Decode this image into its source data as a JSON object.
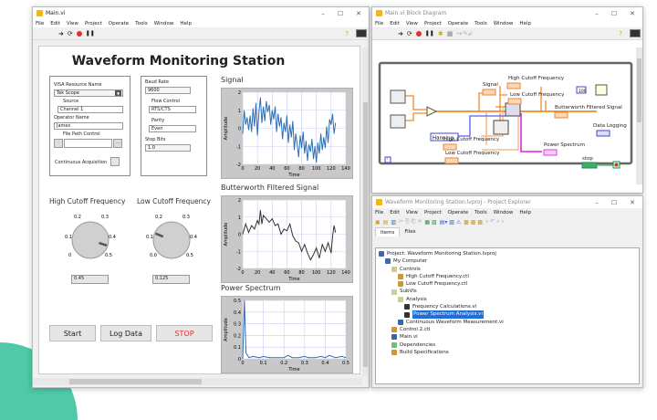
{
  "colors": {
    "accent_teal": "#4fc9a6",
    "wire_orange": "#f08a2a",
    "wire_blue": "#5a5aff",
    "wire_pink": "#e040e0",
    "signal_line": "#2a6fb5",
    "filtered_line": "#333333",
    "stop_red": "#e03030",
    "selection": "#1e6fd9"
  },
  "menu": [
    "File",
    "Edit",
    "View",
    "Project",
    "Operate",
    "Tools",
    "Window",
    "Help"
  ],
  "main_window": {
    "title": "Main.vi",
    "panel_title": "Waveform Monitoring Station",
    "visa": {
      "label": "VISA Resource Name",
      "value": "Tek Scope"
    },
    "source": {
      "label": "Source",
      "value": "Channel 1"
    },
    "operator": {
      "label": "Operator Name",
      "value": "James"
    },
    "file_path": {
      "label": "File Path Control",
      "value": ""
    },
    "continuous": {
      "label": "Continuous Acquisition",
      "checked": false
    },
    "baud": {
      "label": "Baud Rate",
      "value": "9600"
    },
    "flow": {
      "label": "Flow Control",
      "value": "RTS/CTS"
    },
    "parity": {
      "label": "Parity",
      "value": "Even"
    },
    "stop_bits": {
      "label": "Stop Bits",
      "value": "1.0"
    },
    "high_knob": {
      "label": "High Cutoff Frequency",
      "ticks": [
        "0",
        "0.1",
        "0.2",
        "0.3",
        "0.4",
        "0.5"
      ],
      "value": "0.45"
    },
    "low_knob": {
      "label": "Low Cutoff Frequency",
      "ticks": [
        "0.0",
        "0.1",
        "0.2",
        "0.3",
        "0.4",
        "0.5"
      ],
      "value": "0.125"
    },
    "buttons": {
      "start": "Start",
      "log": "Log Data",
      "stop": "STOP"
    }
  },
  "chart_data": [
    {
      "type": "line",
      "title": "Signal",
      "xlabel": "Time",
      "ylabel": "Amplitude",
      "xlim": [
        0,
        140
      ],
      "ylim": [
        -2,
        2
      ],
      "xticks": [
        "0",
        "20",
        "40",
        "60",
        "80",
        "100",
        "120",
        "140"
      ],
      "yticks": [
        "2",
        "1",
        "0",
        "-1",
        "-2"
      ],
      "grid": true,
      "color": "#2a6fb5",
      "x": [
        0,
        2,
        4,
        6,
        8,
        10,
        12,
        14,
        16,
        18,
        20,
        22,
        24,
        26,
        28,
        30,
        32,
        34,
        36,
        38,
        40,
        42,
        44,
        46,
        48,
        50,
        52,
        54,
        56,
        58,
        60,
        62,
        64,
        66,
        68,
        70,
        72,
        74,
        76,
        78,
        80,
        82,
        84,
        86,
        88,
        90,
        92,
        94,
        96,
        98,
        100,
        102,
        104,
        106,
        108,
        110,
        112,
        114,
        116,
        118,
        120,
        122,
        124,
        126
      ],
      "y": [
        -0.3,
        1.0,
        0.2,
        0.6,
        -0.1,
        0.7,
        -0.2,
        1.1,
        0.1,
        1.4,
        -0.4,
        0.9,
        1.7,
        0.3,
        1.2,
        0.4,
        1.5,
        0.9,
        1.3,
        0.2,
        1.0,
        0.5,
        1.2,
        -0.2,
        0.8,
        0.1,
        0.6,
        -0.6,
        0.3,
        -0.2,
        0.7,
        -0.8,
        0.2,
        -0.5,
        0.4,
        -1.2,
        -0.3,
        -0.9,
        -1.6,
        -0.4,
        -1.1,
        -0.2,
        -1.4,
        -0.7,
        -1.8,
        -0.9,
        -1.3,
        -0.6,
        -1.7,
        -1.0,
        -1.9,
        -0.8,
        -1.4,
        -0.3,
        -1.2,
        -0.5,
        -1.1,
        0.1,
        -0.8,
        0.5,
        0.2,
        0.8,
        -0.3,
        0.3
      ]
    },
    {
      "type": "line",
      "title": "Butterworth Filtered Signal",
      "xlabel": "Time",
      "ylabel": "Amplitude",
      "xlim": [
        0,
        140
      ],
      "ylim": [
        -2,
        2
      ],
      "xticks": [
        "0",
        "20",
        "40",
        "60",
        "80",
        "100",
        "120",
        "140"
      ],
      "yticks": [
        "2",
        "1",
        "0",
        "-1",
        "-2"
      ],
      "grid": true,
      "color": "#333333",
      "x": [
        0,
        4,
        8,
        12,
        16,
        20,
        22,
        24,
        26,
        28,
        32,
        36,
        40,
        44,
        48,
        52,
        56,
        60,
        64,
        68,
        72,
        76,
        80,
        84,
        88,
        92,
        96,
        100,
        104,
        108,
        112,
        116,
        120,
        122,
        124,
        126
      ],
      "y": [
        0,
        0.6,
        0.1,
        0.5,
        0.3,
        0.8,
        0.6,
        1.4,
        0.6,
        1.1,
        0.9,
        0.7,
        0.9,
        0.5,
        0.6,
        0.0,
        0.3,
        0.2,
        0.6,
        -0.1,
        -0.4,
        -0.5,
        -1.0,
        -0.6,
        -1.1,
        -1.5,
        -1.2,
        -0.8,
        -1.4,
        -0.6,
        -1.0,
        -0.5,
        -1.1,
        -0.1,
        0.5,
        0.1
      ]
    },
    {
      "type": "line",
      "title": "Power Spectrum",
      "xlabel": "Time",
      "ylabel": "Amplitude",
      "xlim": [
        0,
        0.5
      ],
      "ylim": [
        0,
        0.5
      ],
      "xticks": [
        "0",
        "0.1",
        "0.2",
        "0.3",
        "0.4",
        "0.5"
      ],
      "yticks": [
        "0.5",
        "0.4",
        "0.3",
        "0.2",
        "0.1",
        "0"
      ],
      "grid": true,
      "color": "#2a6fb5",
      "x": [
        0,
        0.008,
        0.016,
        0.03,
        0.05,
        0.08,
        0.1,
        0.13,
        0.16,
        0.2,
        0.22,
        0.24,
        0.27,
        0.3,
        0.32,
        0.35,
        0.38,
        0.4,
        0.42,
        0.45,
        0.48,
        0.5
      ],
      "y": [
        0.0,
        0.5,
        0.05,
        0.01,
        0.02,
        0.01,
        0.02,
        0.01,
        0.01,
        0.01,
        0.03,
        0.01,
        0.01,
        0.02,
        0.01,
        0.01,
        0.02,
        0.01,
        0.03,
        0.01,
        0.02,
        0.01
      ]
    }
  ],
  "block_diagram": {
    "title": "Main.vi Block Diagram",
    "labels": {
      "signal": "Signal",
      "high": "High Cutoff Frequency",
      "low": "Low Cutoff Frequency",
      "butter": "Butterworth Filtered Signal",
      "logging": "Data Logging",
      "power": "Power Spectrum",
      "high2": "High Cutoff Frequency",
      "low2": "Low Cutoff Frequency",
      "window": "Hanning",
      "stop": "stop",
      "wait": "100",
      "loop_i": "i"
    }
  },
  "project_explorer": {
    "title": "Waveform Monitoring Station.lvproj - Project Explorer",
    "tabs": [
      "Items",
      "Files"
    ],
    "tree": [
      {
        "label": "Project: Waveform Monitoring Station.lvproj",
        "depth": 0
      },
      {
        "label": "My Computer",
        "depth": 1
      },
      {
        "label": "Controls",
        "depth": 2
      },
      {
        "label": "High Cutoff Frequency.ctl",
        "depth": 3
      },
      {
        "label": "Low Cutoff Frequency.ctl",
        "depth": 3
      },
      {
        "label": "SubVIs",
        "depth": 2
      },
      {
        "label": "Analysis",
        "depth": 3
      },
      {
        "label": "Frequency Calculations.vi",
        "depth": 4
      },
      {
        "label": "Power Spectrum Analysis.vi",
        "depth": 4,
        "selected": true
      },
      {
        "label": "Continuous Waveform Measurement.vi",
        "depth": 3
      },
      {
        "label": "Control 2.ctl",
        "depth": 2
      },
      {
        "label": "Main.vi",
        "depth": 2
      },
      {
        "label": "Dependencies",
        "depth": 2
      },
      {
        "label": "Build Specifications",
        "depth": 2
      }
    ]
  }
}
